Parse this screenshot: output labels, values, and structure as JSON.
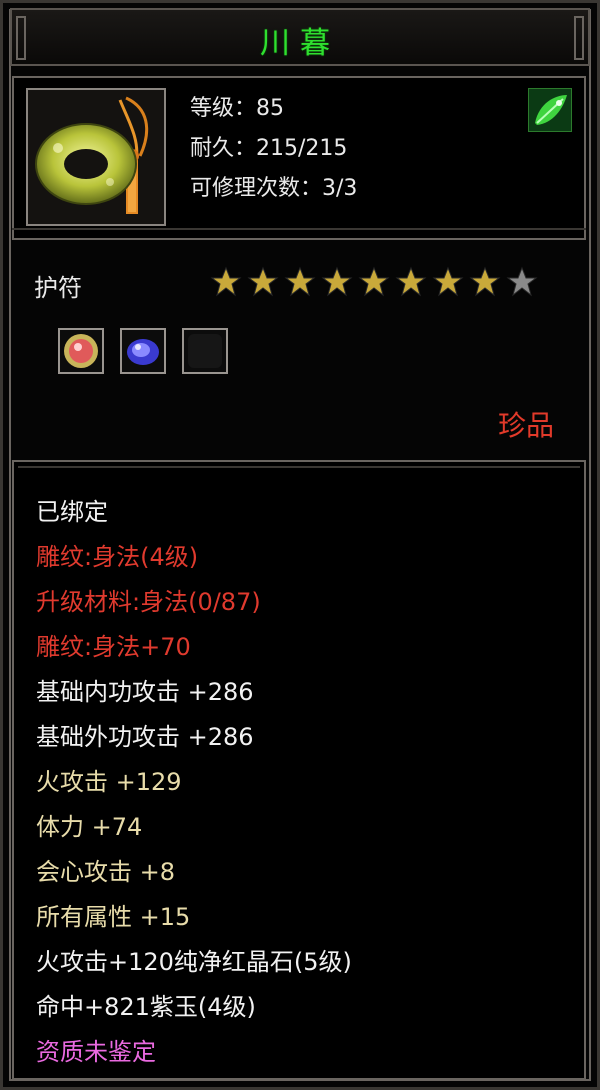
{
  "item": {
    "name": "川暮",
    "level_text": "等级：85",
    "durability_text": "耐久：215/215",
    "repair_text": "可修理次数：3/3",
    "type": "护符",
    "stars_total": 9,
    "stars_filled": 8,
    "rarity": "珍品",
    "icon": "jade-amulet-icon",
    "badge_icon": "green-leaf-icon",
    "gem_slots": [
      {
        "icon": "red-crystal-gem-icon"
      },
      {
        "icon": "purple-jade-gem-icon"
      },
      {
        "icon": "empty-slot-icon"
      }
    ]
  },
  "attributes": [
    {
      "text": "已绑定",
      "color": "white"
    },
    {
      "text": "雕纹:身法(4级)",
      "color": "red"
    },
    {
      "text": "升级材料:身法(0/87)",
      "color": "red"
    },
    {
      "text": "雕纹:身法+70",
      "color": "red"
    },
    {
      "text": "基础内功攻击  +286",
      "color": "white"
    },
    {
      "text": "基础外功攻击  +286",
      "color": "white"
    },
    {
      "text": "火攻击  +129",
      "color": "gold"
    },
    {
      "text": "体力  +74",
      "color": "gold"
    },
    {
      "text": "会心攻击  +8",
      "color": "gold"
    },
    {
      "text": "所有属性  +15",
      "color": "gold"
    },
    {
      "text": "火攻击+120纯净红晶石(5级)",
      "color": "white"
    },
    {
      "text": "命中+821紫玉(4级)",
      "color": "white"
    },
    {
      "text": "资质未鉴定",
      "color": "purple"
    }
  ],
  "colors": {
    "title": "#2fe02f",
    "red": "#e03a2e",
    "gold": "#e8dcaa",
    "purple": "#ea6ae0",
    "star_filled": "#c9a93a",
    "star_empty": "#8a8a8a"
  }
}
